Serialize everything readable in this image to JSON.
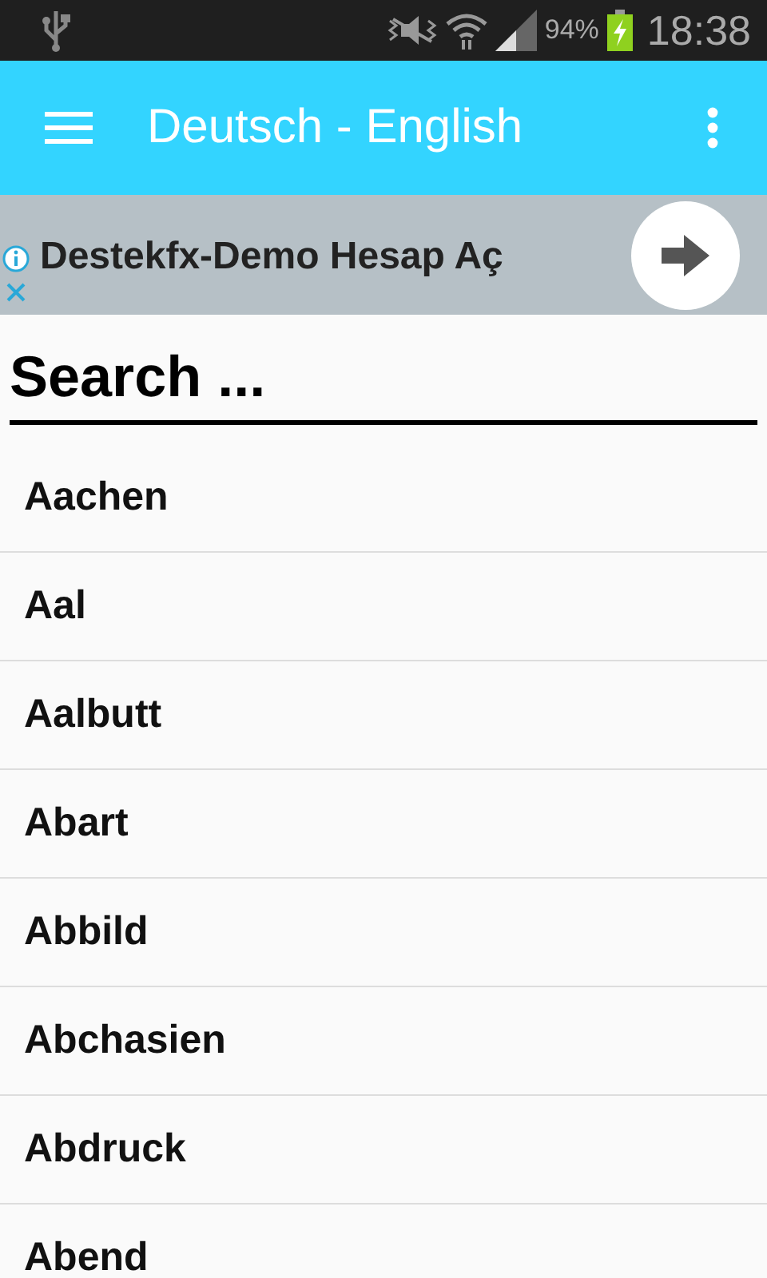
{
  "status_bar": {
    "battery_text": "94%",
    "time": "18:38"
  },
  "toolbar": {
    "title": "Deutsch - English"
  },
  "ad": {
    "text": "Destekfx-Demo Hesap Aç"
  },
  "search": {
    "placeholder": "Search ..."
  },
  "words": [
    "Aachen",
    "Aal",
    "Aalbutt",
    "Abart",
    "Abbild",
    "Abchasien",
    "Abdruck",
    "Abend"
  ]
}
